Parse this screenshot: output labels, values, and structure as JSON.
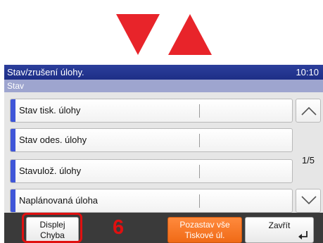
{
  "header": {
    "title": "Stav/zrušení úlohy.",
    "time": "10:10"
  },
  "subheader": {
    "label": "Stav"
  },
  "list": {
    "items": [
      {
        "label": "Stav tisk. úlohy"
      },
      {
        "label": "Stav odes. úlohy"
      },
      {
        "label": "Stavulož. úlohy"
      },
      {
        "label": "Naplánovaná úloha"
      }
    ]
  },
  "pagination": {
    "page": "1/5"
  },
  "footer": {
    "display_error": [
      "Displej",
      "Chyba"
    ],
    "pause_all": [
      "Pozastav vše",
      "Tiskové úl."
    ],
    "close": "Zavřít"
  },
  "annotation": {
    "step_number": "6"
  },
  "colors": {
    "accent_blue": "#3f56d8",
    "title_bar": "#253896",
    "orange": "#f47a2a",
    "marker_red": "#e01010"
  },
  "icons": [
    "arrow-down-icon",
    "arrow-up-icon",
    "chevron-up-icon",
    "chevron-down-icon",
    "enter-icon"
  ]
}
